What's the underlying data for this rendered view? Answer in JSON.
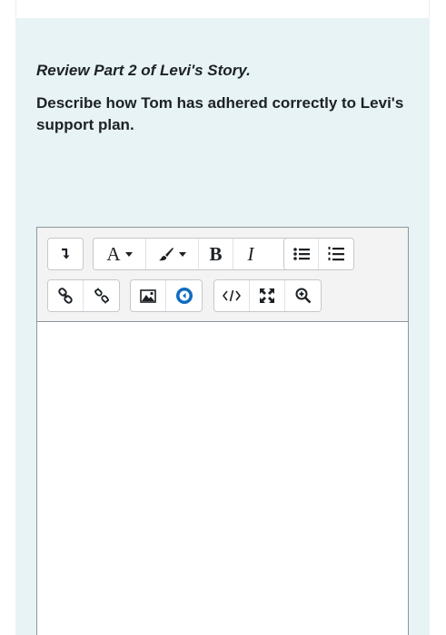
{
  "question": {
    "title": "Review Part 2 of Levi's Story.",
    "text": "Describe how Tom has adhered correctly to Levi's support plan."
  },
  "editor": {
    "content": "",
    "toolbar": {
      "row1": [
        {
          "name": "collapse",
          "icon": "arrow-down-icon"
        },
        {
          "name": "font-style",
          "label": "A",
          "icon": "caret-down-icon"
        },
        {
          "name": "font-color",
          "icon": "paintbrush-icon"
        },
        {
          "name": "bold",
          "label": "B"
        },
        {
          "name": "italic",
          "label": "I"
        },
        {
          "name": "unordered-list",
          "icon": "bullet-list-icon"
        },
        {
          "name": "ordered-list",
          "icon": "numbered-list-icon"
        }
      ],
      "row2": [
        {
          "name": "link",
          "icon": "link-icon"
        },
        {
          "name": "unlink",
          "icon": "unlink-icon"
        },
        {
          "name": "image",
          "icon": "image-icon"
        },
        {
          "name": "media",
          "icon": "media-icon"
        },
        {
          "name": "html",
          "icon": "code-icon"
        },
        {
          "name": "fullscreen",
          "icon": "expand-icon"
        },
        {
          "name": "zoom",
          "icon": "zoom-in-icon"
        }
      ]
    }
  },
  "colors": {
    "panel_background": "#e7f3f5",
    "toolbar_background": "#f3f3f3",
    "media_accent": "#0f6cbf",
    "text": "#1d2125"
  }
}
